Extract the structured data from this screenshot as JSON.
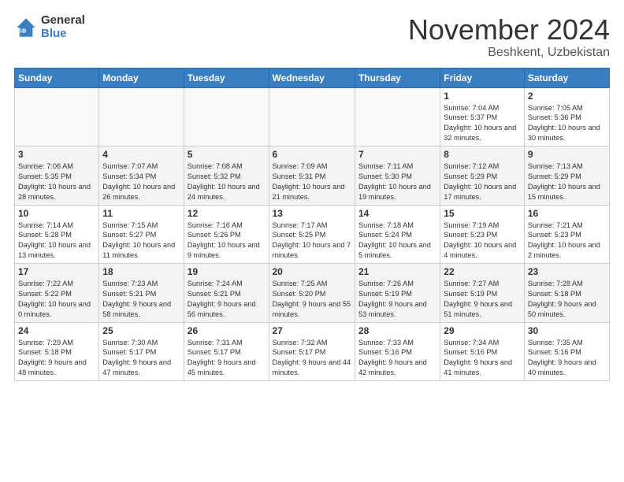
{
  "header": {
    "logo_general": "General",
    "logo_blue": "Blue",
    "month_title": "November 2024",
    "location": "Beshkent, Uzbekistan"
  },
  "weekdays": [
    "Sunday",
    "Monday",
    "Tuesday",
    "Wednesday",
    "Thursday",
    "Friday",
    "Saturday"
  ],
  "weeks": [
    [
      {
        "day": "",
        "info": ""
      },
      {
        "day": "",
        "info": ""
      },
      {
        "day": "",
        "info": ""
      },
      {
        "day": "",
        "info": ""
      },
      {
        "day": "",
        "info": ""
      },
      {
        "day": "1",
        "info": "Sunrise: 7:04 AM\nSunset: 5:37 PM\nDaylight: 10 hours and 32 minutes."
      },
      {
        "day": "2",
        "info": "Sunrise: 7:05 AM\nSunset: 5:36 PM\nDaylight: 10 hours and 30 minutes."
      }
    ],
    [
      {
        "day": "3",
        "info": "Sunrise: 7:06 AM\nSunset: 5:35 PM\nDaylight: 10 hours and 28 minutes."
      },
      {
        "day": "4",
        "info": "Sunrise: 7:07 AM\nSunset: 5:34 PM\nDaylight: 10 hours and 26 minutes."
      },
      {
        "day": "5",
        "info": "Sunrise: 7:08 AM\nSunset: 5:32 PM\nDaylight: 10 hours and 24 minutes."
      },
      {
        "day": "6",
        "info": "Sunrise: 7:09 AM\nSunset: 5:31 PM\nDaylight: 10 hours and 21 minutes."
      },
      {
        "day": "7",
        "info": "Sunrise: 7:11 AM\nSunset: 5:30 PM\nDaylight: 10 hours and 19 minutes."
      },
      {
        "day": "8",
        "info": "Sunrise: 7:12 AM\nSunset: 5:29 PM\nDaylight: 10 hours and 17 minutes."
      },
      {
        "day": "9",
        "info": "Sunrise: 7:13 AM\nSunset: 5:29 PM\nDaylight: 10 hours and 15 minutes."
      }
    ],
    [
      {
        "day": "10",
        "info": "Sunrise: 7:14 AM\nSunset: 5:28 PM\nDaylight: 10 hours and 13 minutes."
      },
      {
        "day": "11",
        "info": "Sunrise: 7:15 AM\nSunset: 5:27 PM\nDaylight: 10 hours and 11 minutes."
      },
      {
        "day": "12",
        "info": "Sunrise: 7:16 AM\nSunset: 5:26 PM\nDaylight: 10 hours and 9 minutes."
      },
      {
        "day": "13",
        "info": "Sunrise: 7:17 AM\nSunset: 5:25 PM\nDaylight: 10 hours and 7 minutes."
      },
      {
        "day": "14",
        "info": "Sunrise: 7:18 AM\nSunset: 5:24 PM\nDaylight: 10 hours and 5 minutes."
      },
      {
        "day": "15",
        "info": "Sunrise: 7:19 AM\nSunset: 5:23 PM\nDaylight: 10 hours and 4 minutes."
      },
      {
        "day": "16",
        "info": "Sunrise: 7:21 AM\nSunset: 5:23 PM\nDaylight: 10 hours and 2 minutes."
      }
    ],
    [
      {
        "day": "17",
        "info": "Sunrise: 7:22 AM\nSunset: 5:22 PM\nDaylight: 10 hours and 0 minutes."
      },
      {
        "day": "18",
        "info": "Sunrise: 7:23 AM\nSunset: 5:21 PM\nDaylight: 9 hours and 58 minutes."
      },
      {
        "day": "19",
        "info": "Sunrise: 7:24 AM\nSunset: 5:21 PM\nDaylight: 9 hours and 56 minutes."
      },
      {
        "day": "20",
        "info": "Sunrise: 7:25 AM\nSunset: 5:20 PM\nDaylight: 9 hours and 55 minutes."
      },
      {
        "day": "21",
        "info": "Sunrise: 7:26 AM\nSunset: 5:19 PM\nDaylight: 9 hours and 53 minutes."
      },
      {
        "day": "22",
        "info": "Sunrise: 7:27 AM\nSunset: 5:19 PM\nDaylight: 9 hours and 51 minutes."
      },
      {
        "day": "23",
        "info": "Sunrise: 7:28 AM\nSunset: 5:18 PM\nDaylight: 9 hours and 50 minutes."
      }
    ],
    [
      {
        "day": "24",
        "info": "Sunrise: 7:29 AM\nSunset: 5:18 PM\nDaylight: 9 hours and 48 minutes."
      },
      {
        "day": "25",
        "info": "Sunrise: 7:30 AM\nSunset: 5:17 PM\nDaylight: 9 hours and 47 minutes."
      },
      {
        "day": "26",
        "info": "Sunrise: 7:31 AM\nSunset: 5:17 PM\nDaylight: 9 hours and 45 minutes."
      },
      {
        "day": "27",
        "info": "Sunrise: 7:32 AM\nSunset: 5:17 PM\nDaylight: 9 hours and 44 minutes."
      },
      {
        "day": "28",
        "info": "Sunrise: 7:33 AM\nSunset: 5:16 PM\nDaylight: 9 hours and 42 minutes."
      },
      {
        "day": "29",
        "info": "Sunrise: 7:34 AM\nSunset: 5:16 PM\nDaylight: 9 hours and 41 minutes."
      },
      {
        "day": "30",
        "info": "Sunrise: 7:35 AM\nSunset: 5:16 PM\nDaylight: 9 hours and 40 minutes."
      }
    ]
  ]
}
